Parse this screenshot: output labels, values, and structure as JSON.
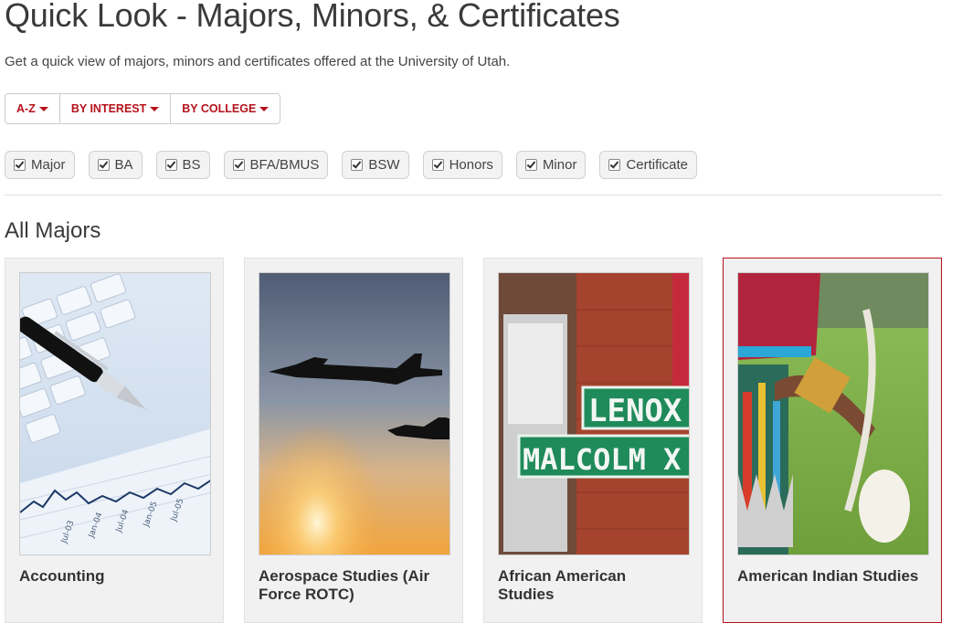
{
  "header": {
    "title": "Quick Look - Majors, Minors, & Certificates",
    "subtitle": "Get a quick view of majors, minors and certificates offered at the University of Utah."
  },
  "filters": {
    "buttons": [
      {
        "label": "A-Z"
      },
      {
        "label": "BY INTEREST"
      },
      {
        "label": "BY COLLEGE"
      }
    ]
  },
  "checkboxes": [
    {
      "label": "Major",
      "checked": true
    },
    {
      "label": "BA",
      "checked": true
    },
    {
      "label": "BS",
      "checked": true
    },
    {
      "label": "BFA/BMUS",
      "checked": true
    },
    {
      "label": "BSW",
      "checked": true
    },
    {
      "label": "Honors",
      "checked": true
    },
    {
      "label": "Minor",
      "checked": true
    },
    {
      "label": "Certificate",
      "checked": true
    }
  ],
  "section": {
    "title": "All Majors"
  },
  "majors": [
    {
      "name": "Accounting",
      "image": "financial-chart-with-pen-image"
    },
    {
      "name": "Aerospace Studies (Air Force ROTC)",
      "image": "fighter-jets-sunset-image"
    },
    {
      "name": "African American Studies",
      "image": "street-signs-image",
      "sign_top": "LENOX AV",
      "sign_bottom": "MALCOLM X BLVD"
    },
    {
      "name": "American Indian Studies",
      "image": "native-regalia-image"
    }
  ],
  "colors": {
    "accent": "#b5121b",
    "card_bg": "#f1f1f1",
    "sign_green": "#1f8a5a"
  }
}
